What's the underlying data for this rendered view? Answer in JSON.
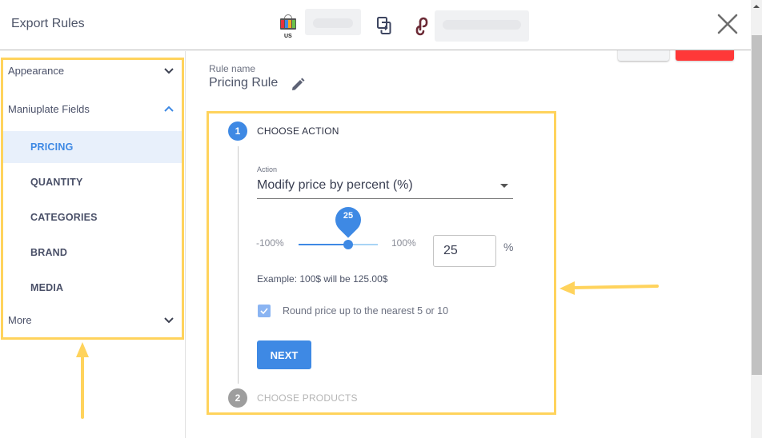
{
  "header": {
    "title": "Export Rules",
    "store_region": "US",
    "close_label": "close"
  },
  "sidebar": {
    "groups": [
      {
        "label": "Appearance",
        "expanded": false
      },
      {
        "label": "Maniuplate Fields",
        "expanded": true
      },
      {
        "label": "More",
        "expanded": false
      }
    ],
    "items": [
      {
        "label": "PRICING",
        "active": true
      },
      {
        "label": "QUANTITY",
        "active": false
      },
      {
        "label": "CATEGORIES",
        "active": false
      },
      {
        "label": "BRAND",
        "active": false
      },
      {
        "label": "MEDIA",
        "active": false
      }
    ]
  },
  "rule": {
    "label": "Rule name",
    "name": "Pricing Rule"
  },
  "stepper": {
    "steps": [
      {
        "number": "1",
        "label": "CHOOSE ACTION",
        "active": true
      },
      {
        "number": "2",
        "label": "CHOOSE PRODUCTS",
        "active": false
      }
    ],
    "action": {
      "label": "Action",
      "value": "Modify price by percent (%)"
    },
    "slider": {
      "min_label": "-100%",
      "max_label": "100%",
      "min": -100,
      "max": 100,
      "value": 25,
      "value_label": "25"
    },
    "percent_input": {
      "value": "25",
      "unit": "%"
    },
    "example": "Example: 100$ will be 125.00$",
    "round_checkbox": {
      "label": "Round price up to the nearest 5 or 10",
      "checked": true
    },
    "next_label": "NEXT"
  },
  "colors": {
    "accent": "#3e89e4",
    "highlight": "#ffd35c",
    "danger": "#ff3838",
    "active_bg": "#e8f0fb"
  }
}
